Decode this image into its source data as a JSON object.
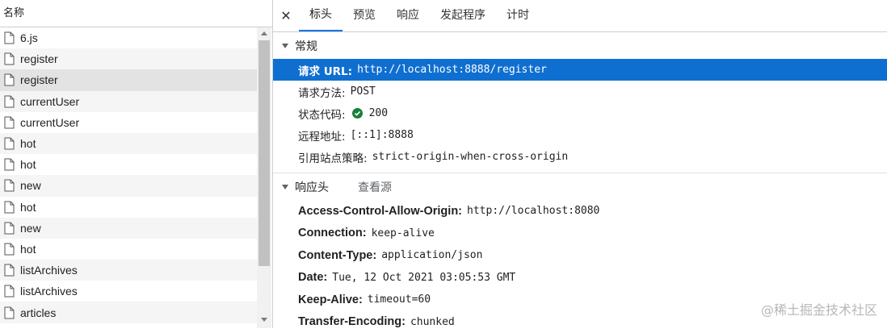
{
  "left": {
    "header": "名称",
    "items": [
      {
        "name": "6.js",
        "selected": false
      },
      {
        "name": "register",
        "selected": false
      },
      {
        "name": "register",
        "selected": true
      },
      {
        "name": "currentUser",
        "selected": false
      },
      {
        "name": "currentUser",
        "selected": false
      },
      {
        "name": "hot",
        "selected": false
      },
      {
        "name": "hot",
        "selected": false
      },
      {
        "name": "new",
        "selected": false
      },
      {
        "name": "hot",
        "selected": false
      },
      {
        "name": "new",
        "selected": false
      },
      {
        "name": "hot",
        "selected": false
      },
      {
        "name": "listArchives",
        "selected": false
      },
      {
        "name": "listArchives",
        "selected": false
      },
      {
        "name": "articles",
        "selected": false
      }
    ]
  },
  "tabs": {
    "close": "✕",
    "items": [
      "标头",
      "预览",
      "响应",
      "发起程序",
      "计时"
    ],
    "active": 0
  },
  "general": {
    "title": "常规",
    "request_url_label": "请求 URL:",
    "request_url": "http://localhost:8888/register",
    "method_label": "请求方法:",
    "method": "POST",
    "status_label": "状态代码:",
    "status": "200",
    "remote_label": "远程地址:",
    "remote": "[::1]:8888",
    "referrer_label": "引用站点策略:",
    "referrer": "strict-origin-when-cross-origin"
  },
  "response_headers": {
    "title": "响应头",
    "view_source": "查看源",
    "items": [
      {
        "k": "Access-Control-Allow-Origin:",
        "v": "http://localhost:8080"
      },
      {
        "k": "Connection:",
        "v": "keep-alive"
      },
      {
        "k": "Content-Type:",
        "v": "application/json"
      },
      {
        "k": "Date:",
        "v": "Tue, 12 Oct 2021 03:05:53 GMT"
      },
      {
        "k": "Keep-Alive:",
        "v": "timeout=60"
      },
      {
        "k": "Transfer-Encoding:",
        "v": "chunked"
      }
    ]
  },
  "watermark": "@稀土掘金技术社区",
  "colors": {
    "selected_row": "#0f6fd1",
    "status_ok": "#188038",
    "tab_underline": "#1a73e8"
  }
}
